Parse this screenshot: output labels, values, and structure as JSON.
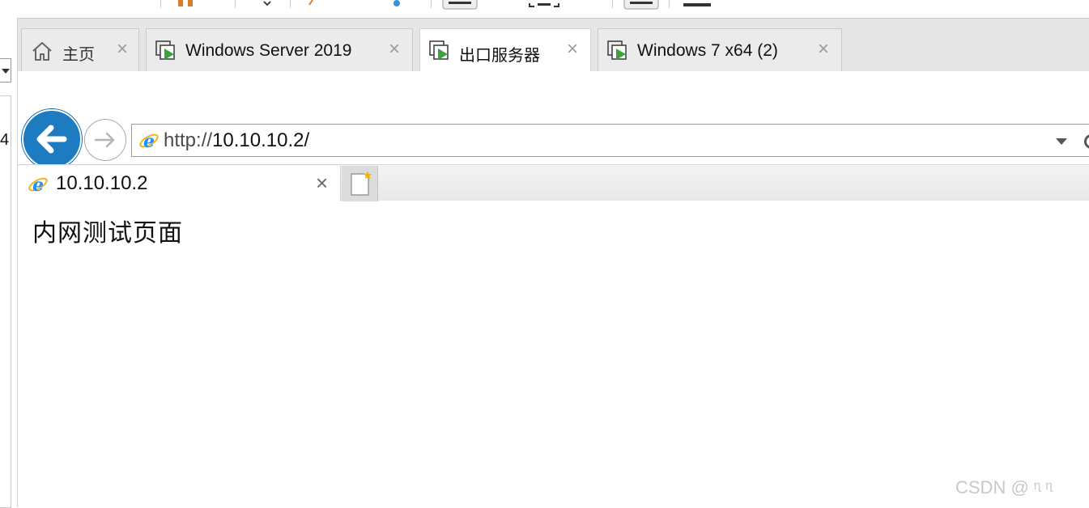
{
  "vm_tabs": [
    {
      "label": "主页",
      "icon": "home-icon",
      "active": false
    },
    {
      "label": "Windows Server 2019",
      "icon": "vm-play-icon",
      "active": false
    },
    {
      "label": "出口服务器",
      "icon": "vm-play-icon",
      "active": true
    },
    {
      "label": "Windows 7 x64 (2)",
      "icon": "vm-play-icon",
      "active": false
    }
  ],
  "left_panel": {
    "text": "4"
  },
  "browser": {
    "url_prefix": "http://",
    "url_host": "10.10.10.2/",
    "tab_title": "10.10.10.2",
    "close_glyph": "×"
  },
  "page": {
    "content_text": "内网测试页面"
  },
  "watermark": {
    "text": "CSDN @ ᶯ      ᶯ"
  },
  "colors": {
    "back_button": "#1d7bc1",
    "vm_play_green": "#3aa33a",
    "ie_blue": "#1e90ff"
  }
}
